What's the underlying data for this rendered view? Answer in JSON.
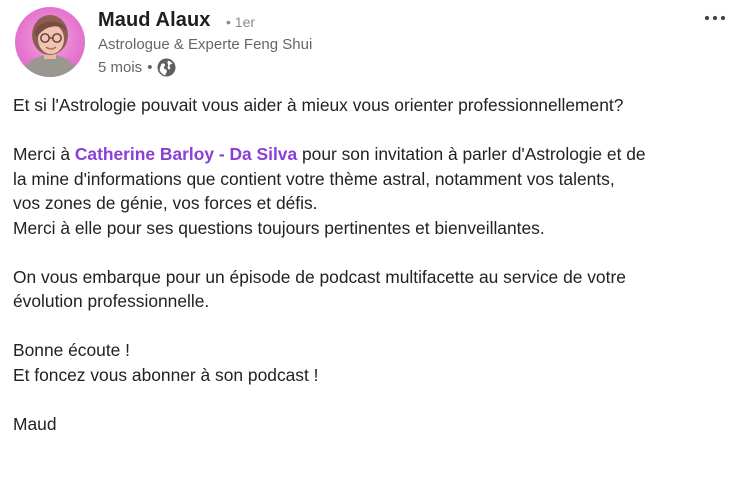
{
  "post": {
    "author": {
      "name": "Maud Alaux",
      "degree": "• 1er",
      "headline": "Astrologue & Experte Feng Shui",
      "time": "5 mois",
      "time_separator": "•",
      "visibility_icon": "globe-icon"
    },
    "menu_icon": "more-horizontal-icon",
    "body": {
      "line1": "Et si l'Astrologie pouvait vous aider à mieux vous orienter professionnellement?",
      "line2_prefix": "Merci à ",
      "mention": "Catherine Barloy - Da Silva",
      "line2_suffix": " pour son invitation à parler d'Astrologie et de",
      "line3": "la mine d'informations que contient votre thème astral, notamment vos talents,",
      "line4": "vos zones de génie, vos forces et défis.",
      "line5": "Merci à elle pour ses questions toujours pertinentes et bienveillantes.",
      "line6": "On vous embarque pour un épisode de podcast multifacette au service de votre",
      "line7": "évolution professionnelle.",
      "line8": "Bonne écoute !",
      "line9": "Et foncez vous abonner à son podcast !",
      "line10": "Maud"
    },
    "colors": {
      "mention": "#8a40d6",
      "secondary_text": "#666666",
      "avatar_background": "#e678cf"
    }
  }
}
